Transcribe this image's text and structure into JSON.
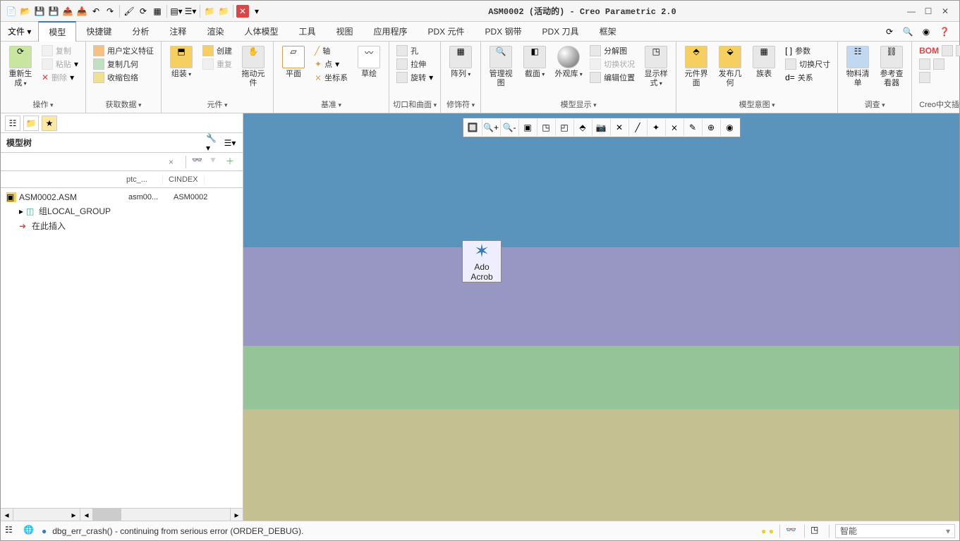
{
  "title": "ASM0002 (活动的) - Creo Parametric 2.0",
  "qat_icons": [
    "new-icon",
    "open-icon",
    "save-icon",
    "saveall-icon",
    "up-icon",
    "down-icon",
    "undo-icon",
    "redo-icon",
    "sep",
    "brush-icon",
    "regen-icon",
    "window-icon",
    "sep",
    "view-icon",
    "layers-icon",
    "sep",
    "folder1-icon",
    "folder2-icon",
    "sep",
    "close-x-icon",
    "sep",
    "dropdown-icon"
  ],
  "menu": {
    "file": "文件",
    "items": [
      "模型",
      "快捷键",
      "分析",
      "注释",
      "渲染",
      "人体模型",
      "工具",
      "视图",
      "应用程序",
      "PDX 元件",
      "PDX 钢带",
      "PDX 刀具",
      "框架"
    ],
    "active_index": 0
  },
  "ribbon": {
    "groups": [
      {
        "label": "操作",
        "dd": true,
        "big": [
          {
            "label": "重新生成",
            "dd": true
          }
        ],
        "small": [
          {
            "label": "复制",
            "disabled": true
          },
          {
            "label": "粘贴",
            "dd": true,
            "disabled": true
          },
          {
            "label": "删除",
            "dd": true,
            "disabled": true
          }
        ]
      },
      {
        "label": "获取数据",
        "dd": true,
        "big": [],
        "small": [
          {
            "label": "用户定义特征"
          },
          {
            "label": "复制几何"
          },
          {
            "label": "收缩包络"
          }
        ]
      },
      {
        "label": "元件",
        "dd": true,
        "big": [
          {
            "label": "组装",
            "dd": true
          },
          {
            "label": "拖动元件"
          }
        ],
        "small": [
          {
            "label": "创建"
          },
          {
            "label": "重复",
            "disabled": true
          }
        ]
      },
      {
        "label": "基准",
        "dd": true,
        "big": [
          {
            "label": "平面"
          },
          {
            "label": "草绘"
          }
        ],
        "small": [
          {
            "label": "轴"
          },
          {
            "label": "点",
            "dd": true
          },
          {
            "label": "坐标系"
          }
        ]
      },
      {
        "label": "切口和曲面",
        "dd": true,
        "big": [],
        "small": [
          {
            "label": "孔"
          },
          {
            "label": "拉伸"
          },
          {
            "label": "旋转",
            "dd": true
          }
        ]
      },
      {
        "label": "修饰符",
        "dd": true,
        "big": [
          {
            "label": "阵列",
            "dd": true
          }
        ],
        "small": []
      },
      {
        "label": "模型显示",
        "dd": true,
        "big": [
          {
            "label": "管理视图"
          },
          {
            "label": "截面",
            "dd": true
          },
          {
            "label": "外观库",
            "dd": true
          },
          {
            "label": "显示样式",
            "dd": true
          }
        ],
        "small": [
          {
            "label": "分解图"
          },
          {
            "label": "切换状况",
            "disabled": true
          },
          {
            "label": "编辑位置"
          }
        ]
      },
      {
        "label": "模型意图",
        "dd": true,
        "big": [
          {
            "label": "元件界面"
          },
          {
            "label": "发布几何"
          },
          {
            "label": "族表"
          }
        ],
        "small": [
          {
            "label": "参数"
          },
          {
            "label": "切换尺寸"
          },
          {
            "label": "关系"
          }
        ]
      },
      {
        "label": "调查",
        "dd": true,
        "big": [
          {
            "label": "物料清单"
          },
          {
            "label": "参考查看器"
          }
        ],
        "small": []
      },
      {
        "label": "Creo中文插件",
        "dd": false,
        "big": [],
        "small": [
          {
            "label": "BOM"
          },
          {
            "label": " "
          }
        ]
      }
    ],
    "small_icons_extra": {
      "relation_prefix": "d="
    }
  },
  "sidebar": {
    "title": "模型树",
    "search_x": "×",
    "tree_cols": [
      "",
      "ptc_...",
      "CINDEX"
    ],
    "tree": [
      {
        "icon": "asm",
        "label": "ASM0002.ASM",
        "col2": "asm00...",
        "col3": "ASM0002",
        "indent": 0
      },
      {
        "icon": "group",
        "label": "组LOCAL_GROUP",
        "col2": "",
        "col3": "",
        "indent": 1,
        "expand": "▸"
      },
      {
        "icon": "insert",
        "label": "在此插入",
        "col2": "",
        "col3": "",
        "indent": 1
      }
    ]
  },
  "desktop_icon": {
    "line1": "Ado",
    "line2": "Acrob"
  },
  "graphics_tools": [
    "zoom-window",
    "zoom-in",
    "zoom-out",
    "refit",
    "saved-view",
    "view-mgr",
    "named-view",
    "capture",
    "hidden1",
    "hidden2",
    "shade1",
    "shade2",
    "shade3",
    "shade4",
    "perspective"
  ],
  "status": {
    "text": "dbg_err_crash() - continuing from serious error (ORDER_DEBUG).",
    "dropdown": "智能"
  }
}
